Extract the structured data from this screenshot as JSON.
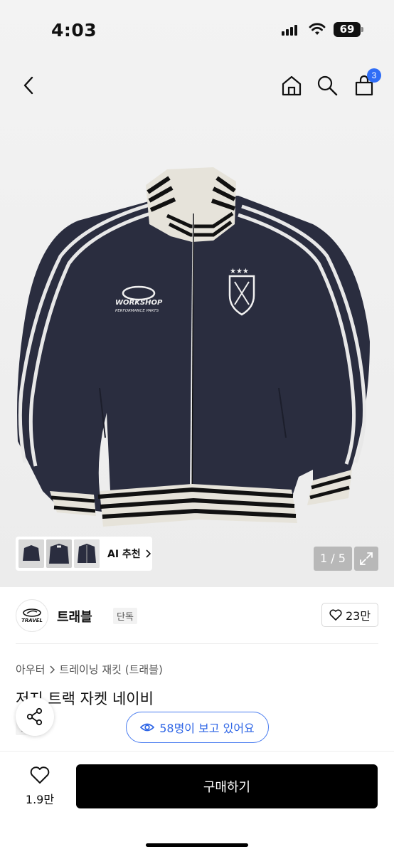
{
  "status_bar": {
    "time": "4:03",
    "battery": "69"
  },
  "nav": {
    "cart_count": "3"
  },
  "gallery": {
    "ai_label": "AI 추천",
    "counter": "1 / 5"
  },
  "brand": {
    "logo_text": "TRAVEL",
    "name": "트래블",
    "tag": "단독",
    "likes": "23만"
  },
  "breadcrumb": {
    "category": "아우터",
    "subcategory": "트레이닝 재킷 (트래블)"
  },
  "product": {
    "title": "저지 트랙 자켓 네이비",
    "exclusive_tag": "단독"
  },
  "viewers": {
    "text": "58명이 보고 있어요"
  },
  "bottom": {
    "wish_count": "1.9만",
    "buy_label": "구매하기"
  },
  "jacket_print": {
    "logo_text": "WORKSHOP",
    "logo_subtext": "PERFORMANCE PARTS"
  },
  "colors": {
    "accent_blue": "#2f6df6",
    "jacket_navy": "#2a2d3f",
    "buy_button": "#000000"
  }
}
